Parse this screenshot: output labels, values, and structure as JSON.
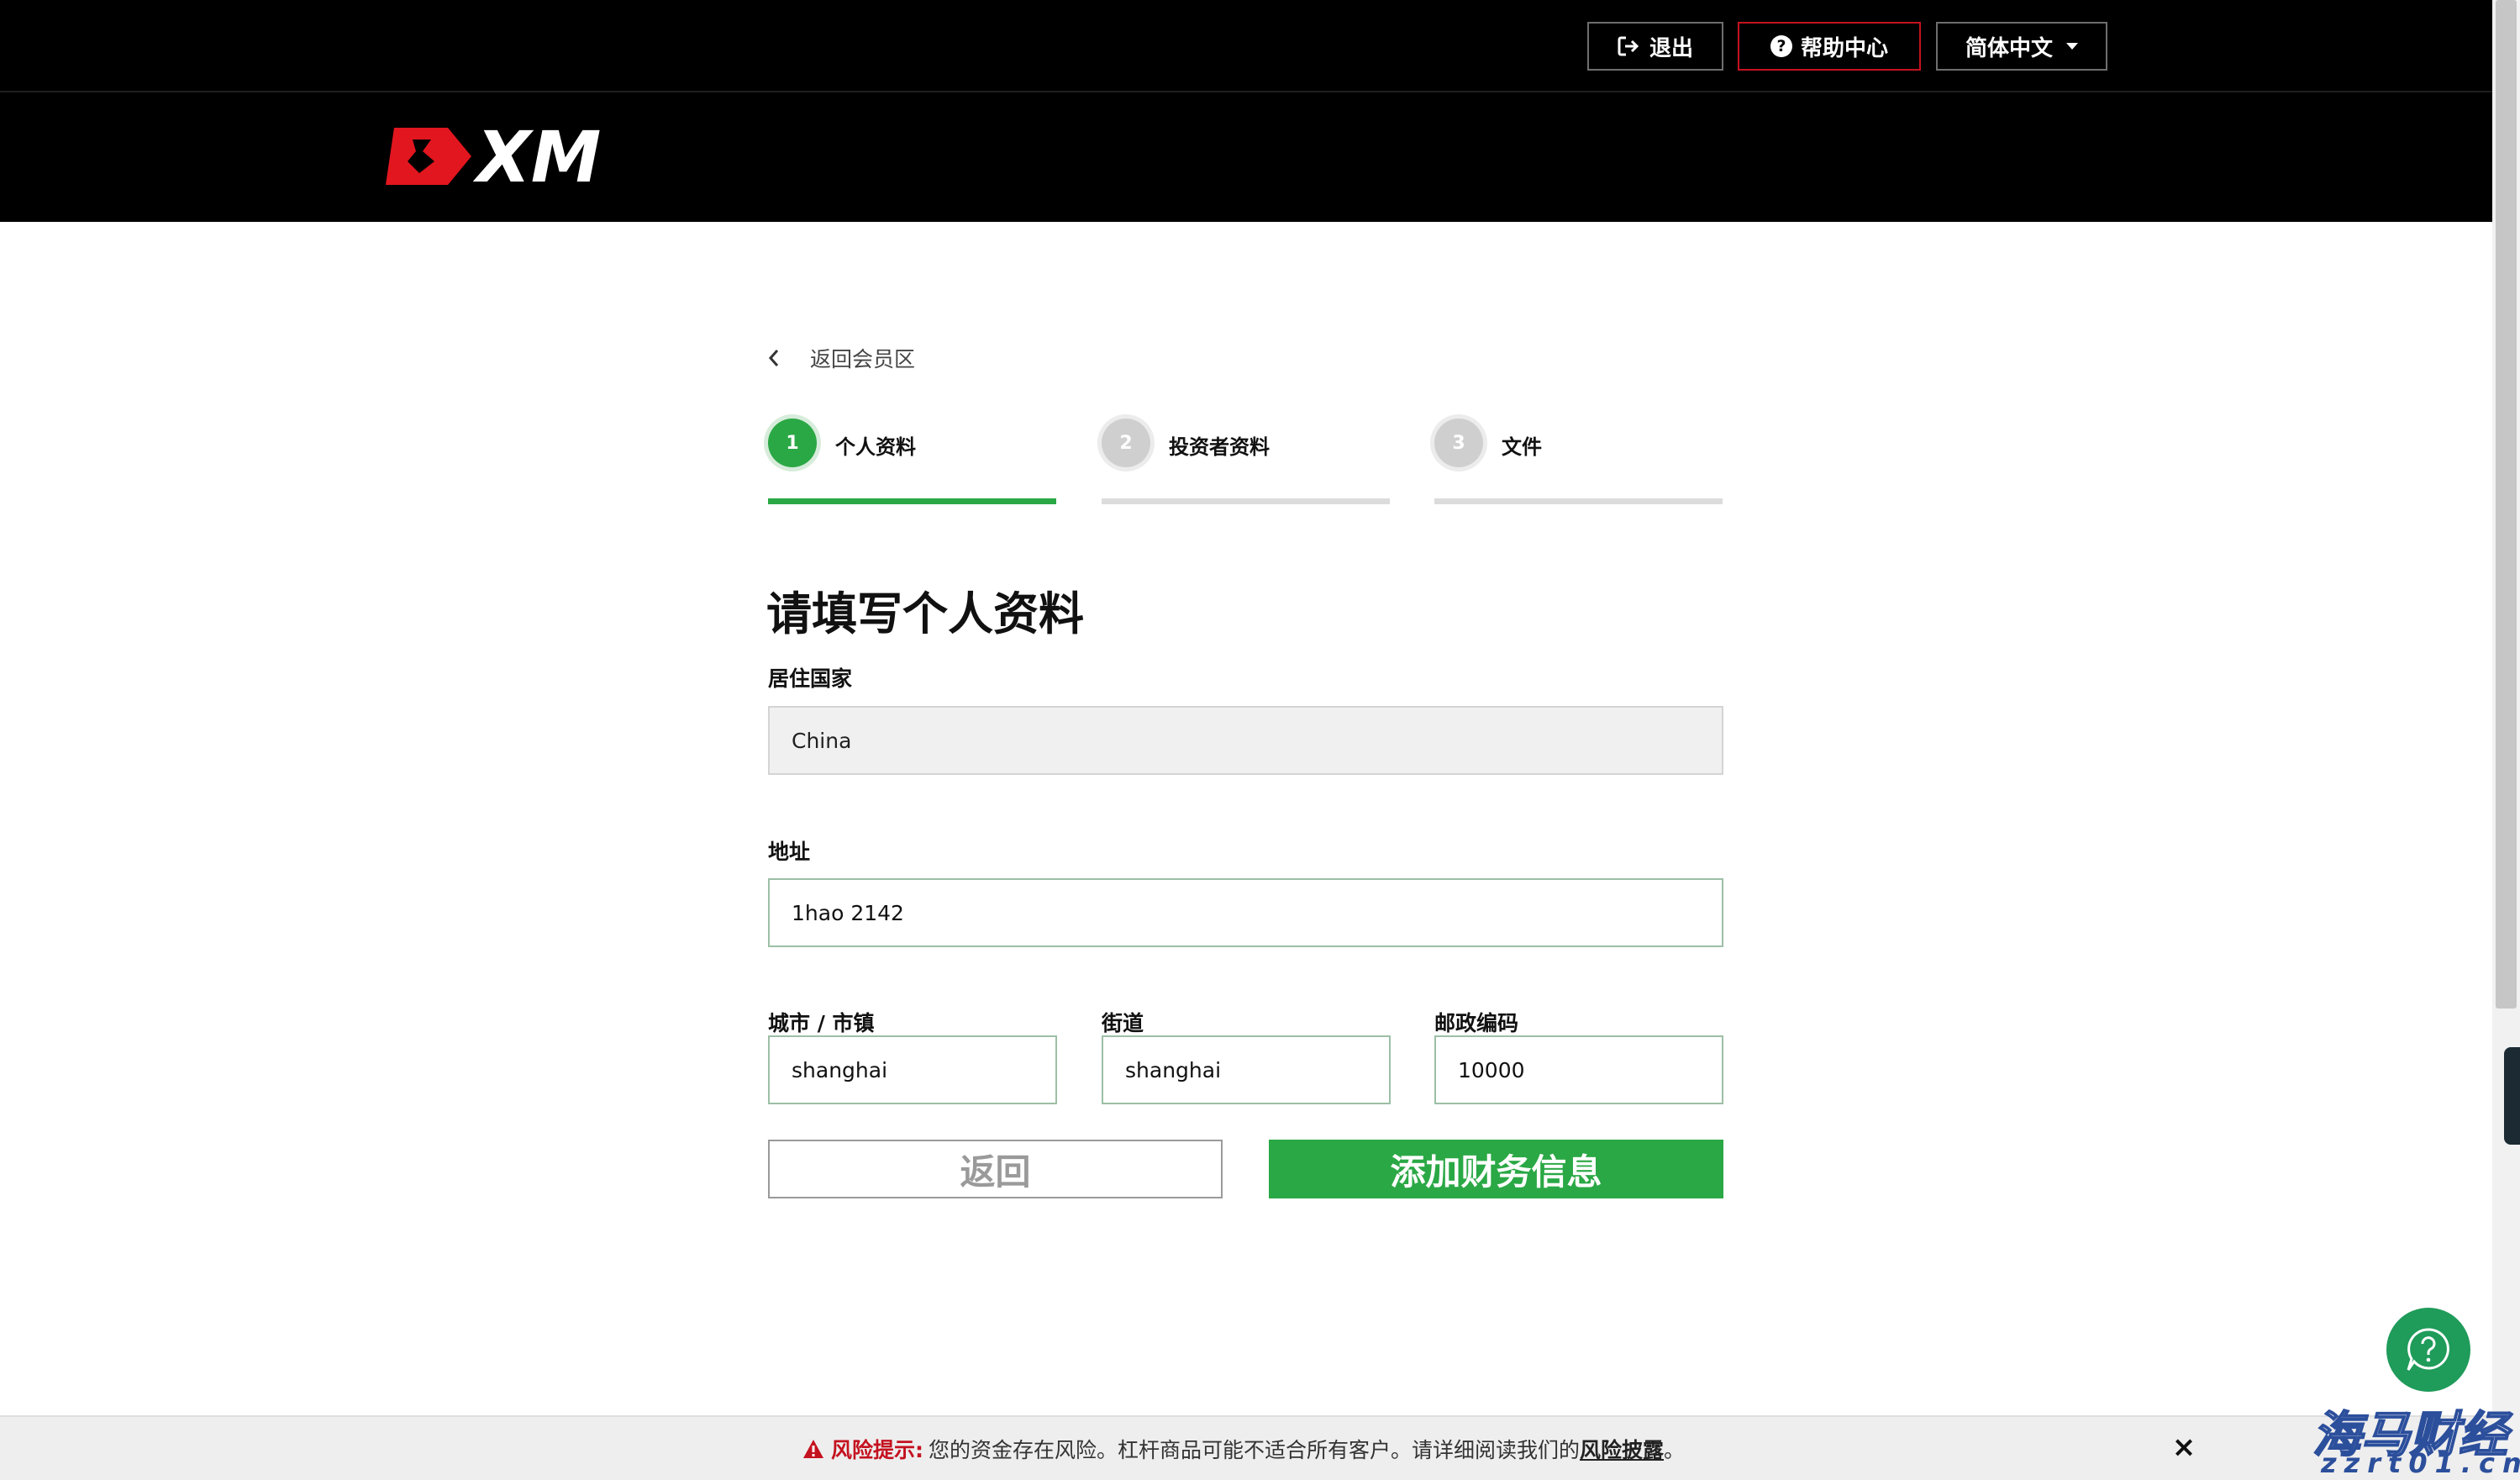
{
  "header": {
    "logout_label": "退出",
    "help_label": "帮助中心",
    "language_label": "简体中文",
    "logo_text": "XM"
  },
  "nav": {
    "back_label": "返回会员区"
  },
  "steps": [
    {
      "number": "1",
      "label": "个人资料",
      "state": "active"
    },
    {
      "number": "2",
      "label": "投资者资料",
      "state": "inactive"
    },
    {
      "number": "3",
      "label": "文件",
      "state": "inactive"
    }
  ],
  "form": {
    "title": "请填写个人资料",
    "country": {
      "label": "居住国家",
      "value": "China"
    },
    "address": {
      "label": "地址",
      "value": "1hao 2142"
    },
    "city": {
      "label": "城市 / 市镇",
      "value": "shanghai"
    },
    "street": {
      "label": "街道",
      "value": "shanghai"
    },
    "postal": {
      "label": "邮政编码",
      "value": "10000"
    },
    "back_button": "返回",
    "next_button": "添加财务信息"
  },
  "risk_banner": {
    "prefix": "风险提示:",
    "text": "您的资金存在风险。杠杆商品可能不适合所有客户。请详细阅读我们的",
    "link": "风险披露",
    "suffix": "。",
    "close": "×"
  },
  "watermark": {
    "main": "海马财经",
    "sub": "zzrt01.cn"
  },
  "colors": {
    "accent_green": "#2aa845",
    "brand_red": "#c4121f",
    "header_bg": "#000000",
    "fab_green": "#1f9b5a"
  },
  "icons": {
    "logout": "logout-icon",
    "help": "question-circle-icon",
    "language": "caret-down-icon",
    "back": "chevron-left-icon",
    "warning": "warning-triangle-icon",
    "close": "close-icon",
    "fab": "help-bubble-icon"
  }
}
